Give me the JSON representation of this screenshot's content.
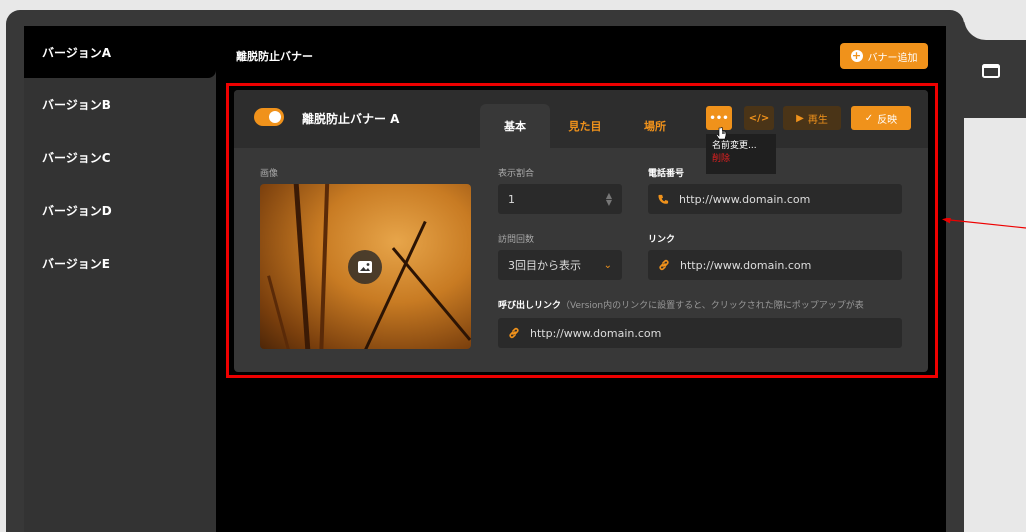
{
  "sidebar": {
    "items": [
      {
        "label": "バージョンA",
        "active": true
      },
      {
        "label": "バージョンB"
      },
      {
        "label": "バージョンC"
      },
      {
        "label": "バージョンD"
      },
      {
        "label": "バージョンE"
      }
    ]
  },
  "header": {
    "title": "離脱防止バナー",
    "add_button": "バナー追加"
  },
  "card": {
    "toggle_on": true,
    "banner_name": "離脱防止バナー A",
    "tabs": [
      "基本",
      "見た目",
      "場所"
    ],
    "buttons": {
      "more": "•••",
      "code": "</>",
      "play": "再生",
      "reflect": "反映"
    },
    "menu": {
      "rename": "名前変更...",
      "delete": "削除"
    },
    "image_label": "画像",
    "display_ratio": {
      "label": "表示割合",
      "value": "1"
    },
    "visit_count": {
      "label": "訪問回数",
      "value": "3回目から表示"
    },
    "phone": {
      "label": "電話番号",
      "value": "http://www.domain.com"
    },
    "link": {
      "label": "リンク",
      "value": "http://www.domain.com"
    },
    "callout_link": {
      "label": "呼び出しリンク",
      "note": "（Version内のリンクに設置すると、クリックされた際にポップアップが表",
      "value": "http://www.domain.com"
    }
  },
  "colors": {
    "accent": "#f0921b",
    "highlight": "#e00000",
    "danger": "#e02020"
  },
  "icons": [
    "window-icon",
    "plus-circle-icon",
    "image-icon",
    "phone-icon",
    "link-icon",
    "play-icon",
    "check-icon",
    "cursor-icon",
    "arrow-icon"
  ]
}
